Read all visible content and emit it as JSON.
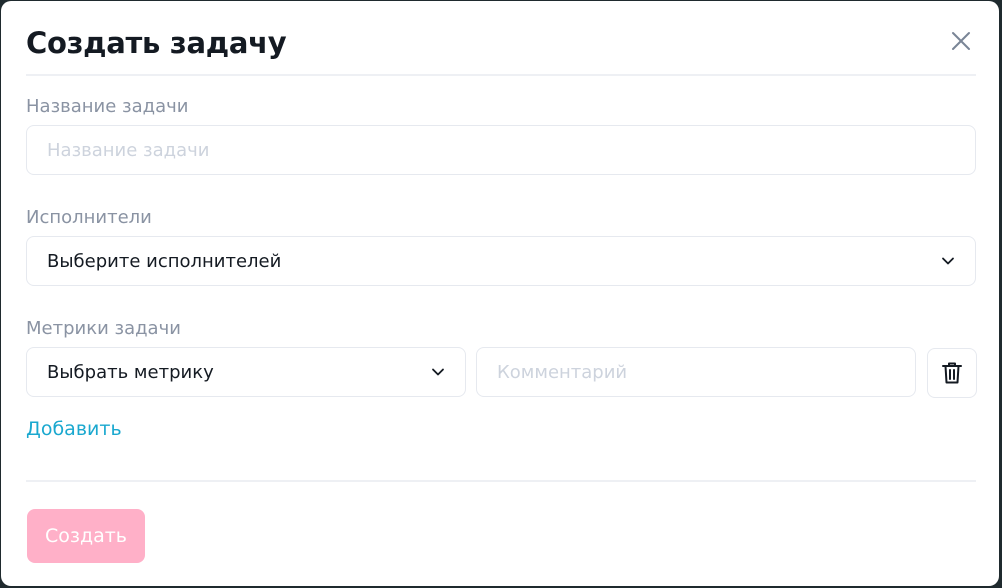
{
  "modal": {
    "title": "Создать задачу",
    "close_icon": "close-icon"
  },
  "task_name": {
    "label": "Название задачи",
    "placeholder": "Название задачи",
    "value": ""
  },
  "assignees": {
    "label": "Исполнители",
    "selected": "Выберите исполнителей"
  },
  "metrics": {
    "label": "Метрики задачи",
    "metric_select": "Выбрать метрику",
    "comment_placeholder": "Комментарий",
    "comment_value": "",
    "delete_icon": "trash-icon"
  },
  "actions": {
    "add_label": "Добавить",
    "submit_label": "Создать"
  },
  "colors": {
    "accent_link": "#1aa8cf",
    "submit_disabled": "#ffb0c8",
    "label_gray": "#8a93a3",
    "border": "#e6e9ef"
  }
}
